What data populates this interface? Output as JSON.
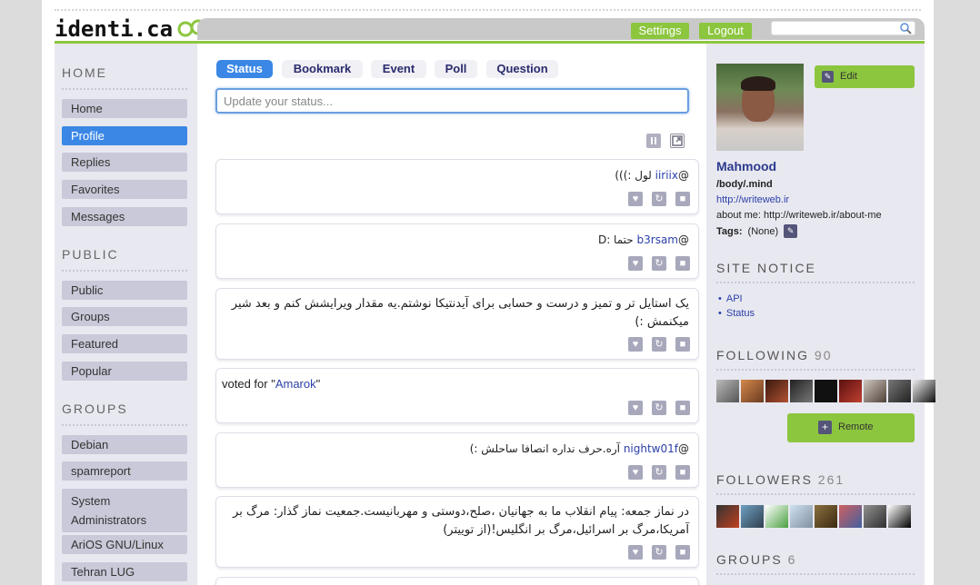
{
  "header": {
    "logo_text": "identi.ca",
    "settings_label": "Settings",
    "logout_label": "Logout",
    "search_placeholder": ""
  },
  "nav": {
    "home_title": "HOME",
    "home_items": [
      "Home",
      "Profile",
      "Replies",
      "Favorites",
      "Messages"
    ],
    "active_item": "Profile",
    "public_title": "PUBLIC",
    "public_items": [
      "Public",
      "Groups",
      "Featured",
      "Popular"
    ],
    "groups_title": "GROUPS",
    "group_items": [
      "Debian",
      "spamreport",
      "System Administrators",
      "AriOS GNU/Linux",
      "Tehran LUG"
    ]
  },
  "composer": {
    "tabs": [
      "Status",
      "Bookmark",
      "Event",
      "Poll",
      "Question"
    ],
    "active_tab": "Status",
    "placeholder": "Update your status..."
  },
  "notices": [
    {
      "prefix": "@",
      "link": "iiriix",
      "text": " لول :)))"
    },
    {
      "prefix": "@",
      "link": "b3rsam",
      "text": " حتما :D"
    },
    {
      "prefix": "",
      "link": "",
      "text": "یک استایل تر و تمیز و درست و حسابی برای آیدنتیکا نوشتم.یه مقدار ویرایشش کنم و بعد شیر میکنمش :)"
    },
    {
      "prefix": "voted for \"",
      "link": "Amarok",
      "suffix": "\"",
      "ltr": true
    },
    {
      "prefix": "@",
      "link": "nightw01f",
      "text": " آره.حرف نداره انصافا ساحلش :)"
    },
    {
      "prefix": "",
      "link": "",
      "text": "در نماز جمعه: پیام انقلاب ما به جهانیان ،صلح،دوستی و مهربانیست.جمعیت نماز گذار: مرگ بر آمریکا،مرگ بر اسرائیل،مرگ بر انگلیس!(از توییتر)"
    }
  ],
  "profile": {
    "edit_label": "Edit",
    "name": "Mahmood",
    "bio": "/body/.mind",
    "url": "http://writeweb.ir",
    "about_label": "about me:",
    "about_value": "http://writeweb.ir/about-me",
    "tags_label": "Tags:",
    "tags_value": "(None)"
  },
  "site_notice": {
    "title": "SITE NOTICE",
    "links": [
      "API",
      "Status"
    ]
  },
  "following": {
    "title": "FOLLOWING",
    "count": "90",
    "remote_label": "Remote"
  },
  "followers": {
    "title": "FOLLOWERS",
    "count": "261"
  },
  "groups": {
    "title": "GROUPS",
    "count": "6"
  },
  "colors": {
    "accent_green": "#8cc63f",
    "accent_blue": "#3b87e6",
    "link": "#2b3fa8"
  }
}
